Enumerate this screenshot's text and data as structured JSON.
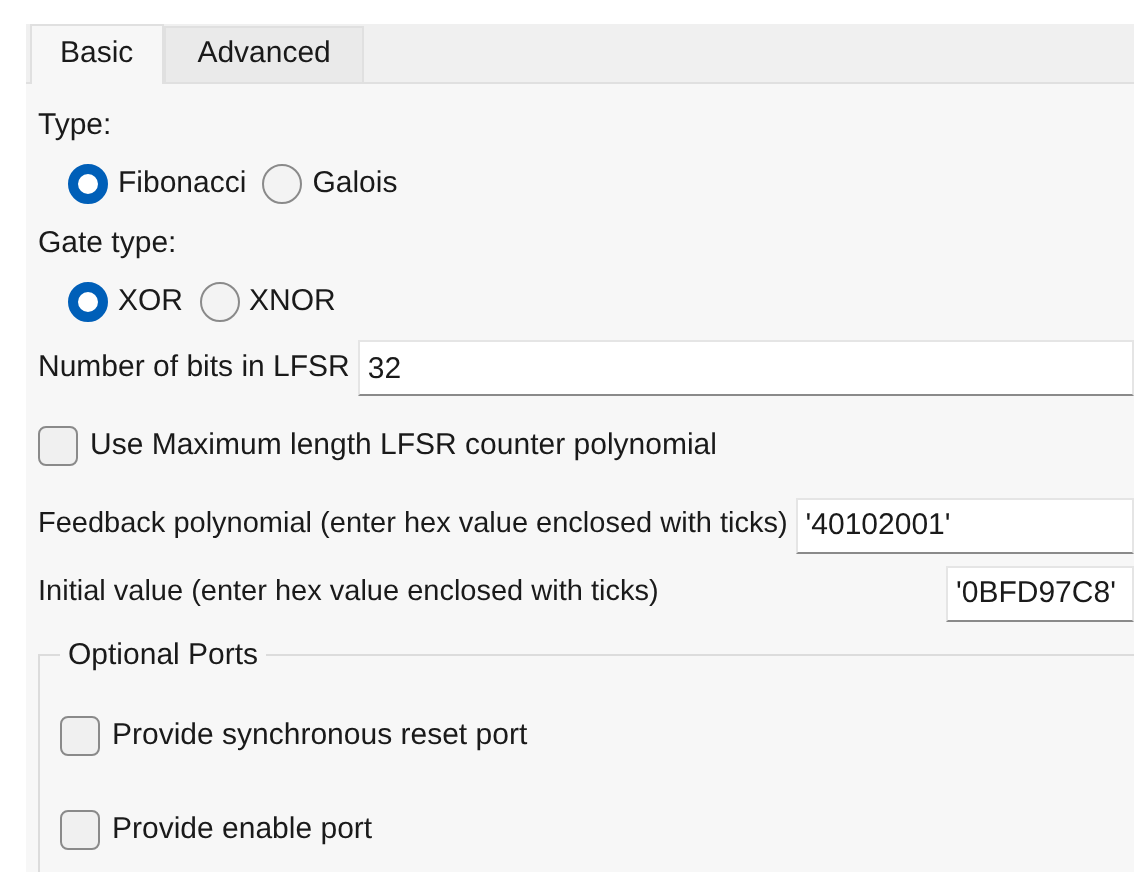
{
  "tabs": [
    {
      "label": "Basic",
      "selected": true
    },
    {
      "label": "Advanced",
      "selected": false
    }
  ],
  "type": {
    "label": "Type:",
    "options": [
      {
        "label": "Fibonacci",
        "selected": true
      },
      {
        "label": "Galois",
        "selected": false
      }
    ]
  },
  "gate_type": {
    "label": "Gate type:",
    "options": [
      {
        "label": "XOR",
        "selected": true
      },
      {
        "label": "XNOR",
        "selected": false
      }
    ]
  },
  "bits": {
    "label": "Number of bits in LFSR",
    "value": "32"
  },
  "max_length": {
    "label": "Use Maximum length LFSR counter polynomial",
    "checked": false
  },
  "feedback": {
    "label": "Feedback polynomial (enter hex value enclosed with ticks)",
    "value": "'40102001'"
  },
  "initial": {
    "label": "Initial value (enter hex value enclosed with ticks)",
    "value": "'0BFD97C8'"
  },
  "optional_ports": {
    "title": "Optional Ports",
    "options": [
      {
        "label": "Provide synchronous reset port",
        "checked": false
      },
      {
        "label": "Provide enable port",
        "checked": false
      }
    ]
  }
}
